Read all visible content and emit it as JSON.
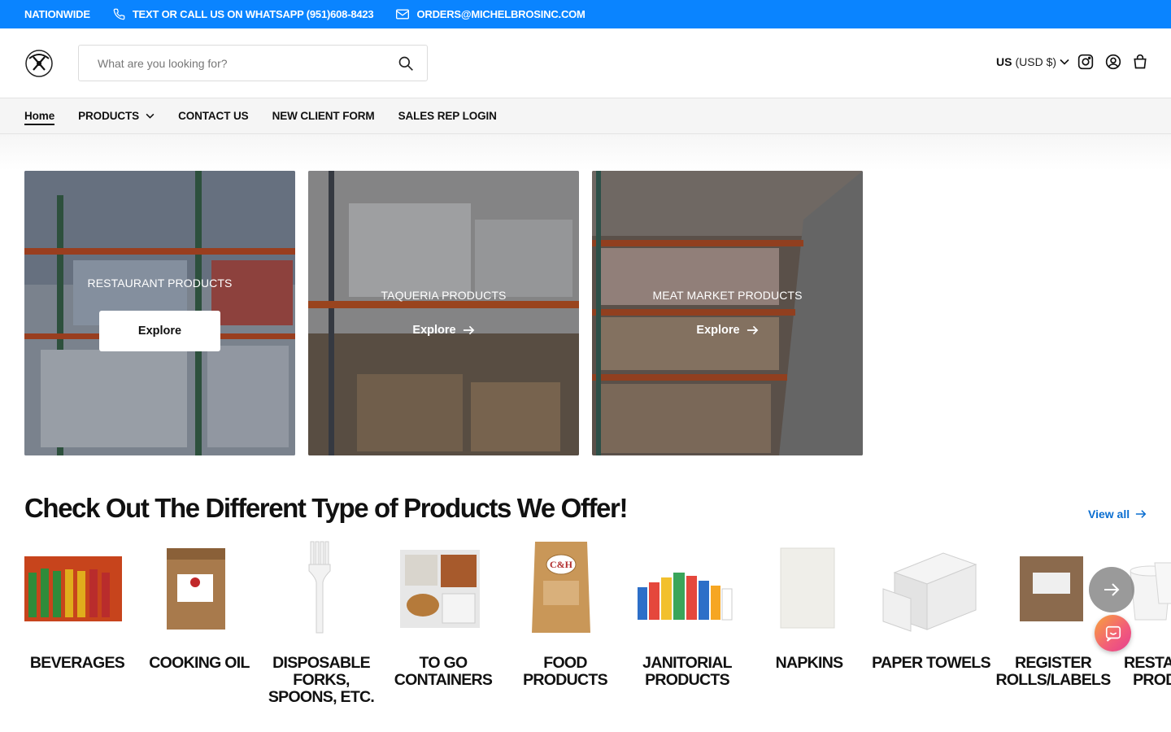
{
  "topbar": {
    "nationwide": "NATIONWIDE",
    "phone_text": "TEXT OR CALL US ON WHATSAPP (951)608-8423",
    "email_text": "ORDERS@MICHELBROSINC.COM",
    "background_color": "#0a84ff"
  },
  "header": {
    "search_placeholder": "What are you looking for?",
    "currency_country": "US",
    "currency_value": "(USD $)",
    "icons": [
      "instagram-icon",
      "account-icon",
      "cart-icon"
    ]
  },
  "nav": {
    "items": [
      {
        "label": "Home"
      },
      {
        "label": "PRODUCTS"
      },
      {
        "label": "CONTACT US"
      },
      {
        "label": "NEW CLIENT FORM"
      },
      {
        "label": "SALES REP LOGIN"
      }
    ]
  },
  "hero_cards": [
    {
      "title": "RESTAURANT PRODUCTS",
      "cta": "Explore"
    },
    {
      "title": "TAQUERIA PRODUCTS",
      "cta": "Explore"
    },
    {
      "title": "MEAT MARKET PRODUCTS",
      "cta": "Explore"
    }
  ],
  "products_section": {
    "title": "Check Out The Different Type of Products We Offer!",
    "view_all": "View all",
    "categories": [
      {
        "label": "BEVERAGES"
      },
      {
        "label": "COOKING OIL"
      },
      {
        "label": "DISPOSABLE FORKS, SPOONS, ETC."
      },
      {
        "label": "TO GO CONTAINERS"
      },
      {
        "label": "FOOD PRODUCTS"
      },
      {
        "label": "JANITORIAL PRODUCTS"
      },
      {
        "label": "NAPKINS"
      },
      {
        "label": "PAPER TOWELS"
      },
      {
        "label": "REGISTER ROLLS/LABELS"
      },
      {
        "label": "RESTAURANT PRODUCTS"
      }
    ]
  },
  "accent_link_color": "#0a6ed1"
}
